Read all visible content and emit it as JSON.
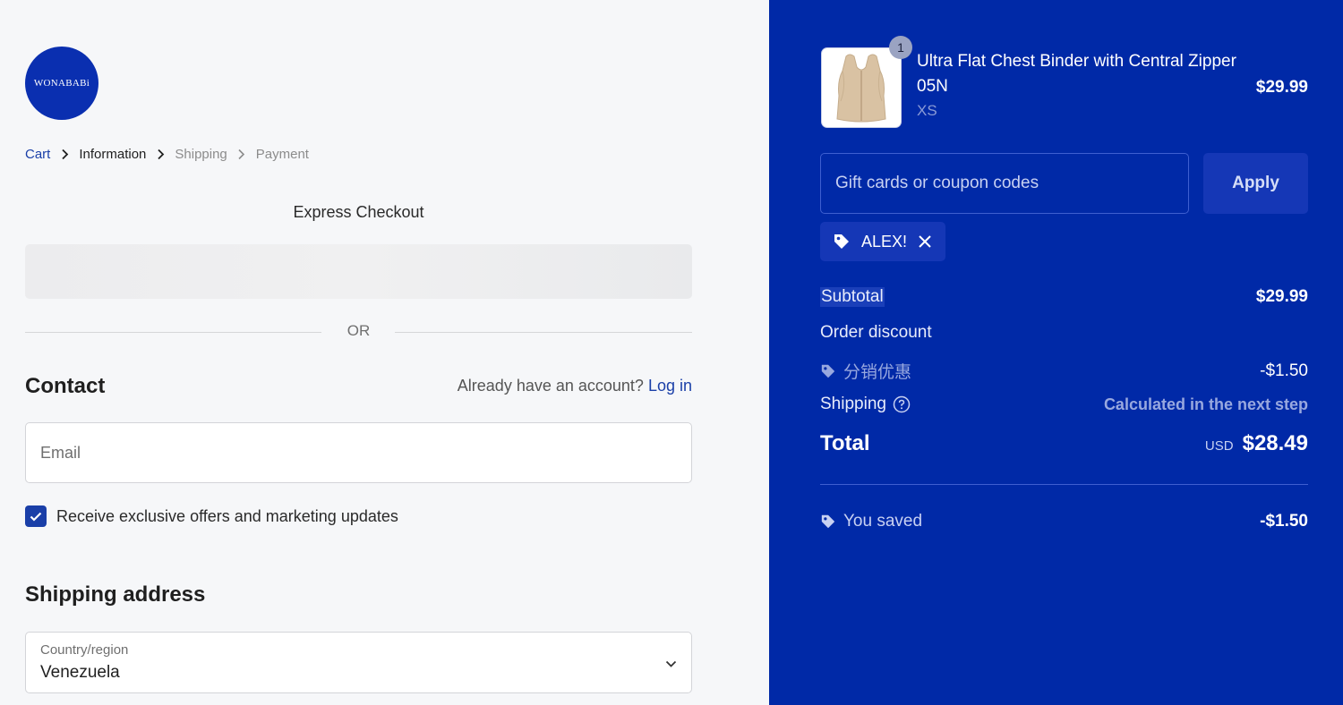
{
  "brand": {
    "logo_text": "WONABABi"
  },
  "breadcrumb": {
    "items": [
      {
        "label": "Cart"
      },
      {
        "label": "Information"
      },
      {
        "label": "Shipping"
      },
      {
        "label": "Payment"
      }
    ]
  },
  "express": {
    "title": "Express Checkout",
    "divider_text": "OR"
  },
  "contact": {
    "heading": "Contact",
    "account_prompt": "Already have an account?",
    "login_label": "Log in",
    "email_placeholder": "Email",
    "marketing_label": "Receive exclusive offers and marketing updates",
    "marketing_checked": true
  },
  "shipping_address": {
    "heading": "Shipping address",
    "country_label": "Country/region",
    "country_value": "Venezuela"
  },
  "order": {
    "item": {
      "name": "Ultra Flat Chest Binder with Central Zipper 05N",
      "variant": "XS",
      "price": "$29.99",
      "quantity": "1"
    },
    "coupon_placeholder": "Gift cards or coupon codes",
    "apply_label": "Apply",
    "applied_code": "ALEX!",
    "subtotal_label": "Subtotal",
    "subtotal_value": "$29.99",
    "discount_label": "Order discount",
    "discount_name": "分销优惠",
    "discount_value": "-$1.50",
    "shipping_label": "Shipping",
    "shipping_value": "Calculated in the next step",
    "total_label": "Total",
    "currency": "USD",
    "total_value": "$28.49",
    "saved_label": "You saved",
    "saved_value": "-$1.50"
  },
  "colors": {
    "accent": "#1a3fa8",
    "summary_bg": "#0029a7",
    "logo_bg": "#0a2fb0"
  },
  "icons": [
    "chevron-right-icon",
    "check-icon",
    "chevron-down-icon",
    "tag-icon",
    "close-icon",
    "question-circle-icon"
  ]
}
